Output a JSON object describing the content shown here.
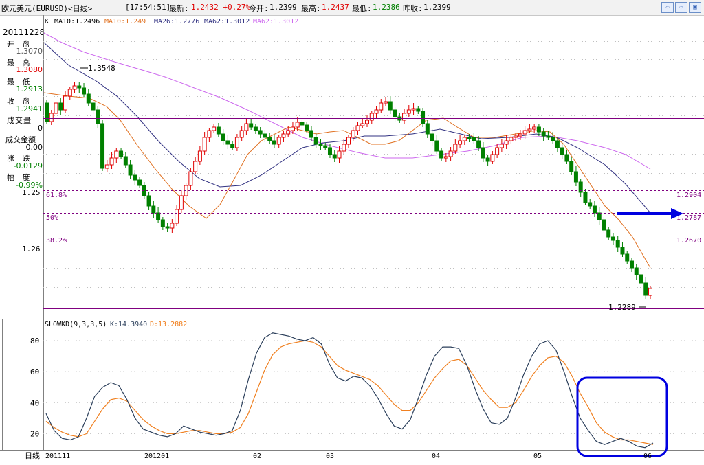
{
  "header": {
    "symbol": "欧元美元(EURUSD)<日线>",
    "time": "[17:54:51]",
    "latest_label": "最新:",
    "latest_value": "1.2432 +0.27%",
    "open_label": "今开:",
    "open_value": "1.2399",
    "high_label": "最高:",
    "high_value": "1.2437",
    "low_label": "最低:",
    "low_value": "1.2386",
    "prev_label": "昨收:",
    "prev_value": "1.2399"
  },
  "info_panel": {
    "date": "20111228",
    "open_label": "开 盘",
    "open_value": "1.3070",
    "high_label": "最 高",
    "high_value": "1.3080",
    "low_label": "最 低",
    "low_value": "1.2913",
    "close_label": "收 盘",
    "close_value": "1.2941",
    "volume_label": "成交量",
    "volume_value": "0",
    "amount_label": "成交金额",
    "amount_value": "0.00",
    "change_label": "涨 跌",
    "change_value": "-0.0129",
    "range_label": "幅 度",
    "range_value": "-0.99%"
  },
  "footer": {
    "period_label": "日线"
  },
  "colors": {
    "up": "#e00000",
    "down": "#008000",
    "ma10": "#e07020",
    "ma26": "#303080",
    "ma62": "#cc66ee",
    "fib": "#800080",
    "kline": "#2a3e5a",
    "dline": "#f08020",
    "highlight": "#0000e0"
  },
  "chart_data": [
    {
      "type": "candlestick",
      "title": "K",
      "moving_averages": [
        {
          "name": "MA10",
          "label": "MA10:1.2496",
          "value": 1.2496
        },
        {
          "name": "MA10",
          "label": "MA10:1.249",
          "value": 1.249
        },
        {
          "name": "MA26",
          "label": "MA26:1.2776",
          "value": 1.2776
        },
        {
          "name": "MA62",
          "label": "MA62:1.3012",
          "value": 1.3012
        },
        {
          "name": "MA62",
          "label": "MA62:1.3012",
          "value": 1.3012
        }
      ],
      "y_ticks": [
        {
          "label": "1.26",
          "value": 1.26
        },
        {
          "label": "1.25",
          "value": 1.25
        }
      ],
      "annotations": {
        "high": "1.3548",
        "low": "1.2289"
      },
      "fibonacci": [
        {
          "ratio": "61.8%",
          "price": "1.2904"
        },
        {
          "ratio": "50%",
          "price": "1.2787"
        },
        {
          "ratio": "38.2%",
          "price": "1.2670"
        }
      ],
      "x_labels": [
        "201111",
        "201201",
        "02",
        "03",
        "04",
        "05",
        "06"
      ]
    },
    {
      "type": "line",
      "title": "SLOWKD(9,3,3,5)",
      "series": [
        {
          "name": "K",
          "label": "K:14.3940"
        },
        {
          "name": "D",
          "label": "D:13.2882"
        }
      ],
      "ylim": [
        10,
        88
      ],
      "y_ticks": [
        80,
        60,
        40,
        20
      ],
      "k_values": [
        33,
        22,
        17,
        16,
        18,
        30,
        44,
        50,
        53,
        51,
        42,
        30,
        23,
        21,
        19,
        18,
        20,
        25,
        23,
        21,
        20,
        19,
        20,
        22,
        35,
        55,
        72,
        82,
        85,
        84,
        83,
        81,
        80,
        82,
        78,
        65,
        56,
        54,
        57,
        56,
        51,
        43,
        33,
        25,
        23,
        29,
        43,
        58,
        70,
        76,
        76,
        75,
        64,
        49,
        36,
        27,
        26,
        30,
        43,
        58,
        70,
        78,
        80,
        74,
        60,
        44,
        30,
        22,
        15,
        13,
        15,
        17,
        15,
        12,
        11,
        14
      ],
      "d_values": [
        28,
        24,
        21,
        19,
        18,
        20,
        28,
        36,
        42,
        43,
        41,
        35,
        29,
        25,
        22,
        20,
        20,
        21,
        22,
        22,
        21,
        20,
        20,
        21,
        24,
        33,
        47,
        61,
        71,
        76,
        78,
        79,
        80,
        79,
        76,
        70,
        64,
        61,
        59,
        57,
        55,
        51,
        45,
        39,
        35,
        35,
        40,
        48,
        56,
        62,
        67,
        68,
        64,
        56,
        48,
        42,
        37,
        37,
        40,
        48,
        57,
        64,
        69,
        70,
        66,
        57,
        46,
        37,
        27,
        21,
        18,
        16,
        16,
        15,
        14,
        13
      ]
    }
  ]
}
